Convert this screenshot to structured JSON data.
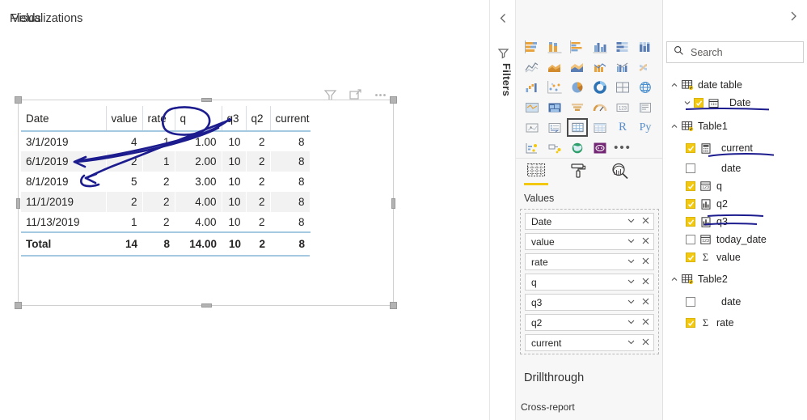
{
  "canvas": {
    "visual_header_icons": [
      "filter-icon",
      "focus-mode-icon",
      "more-options-icon"
    ],
    "table": {
      "columns": [
        "Date",
        "value",
        "rate",
        "q",
        "q3",
        "q2",
        "current"
      ],
      "rows": [
        [
          "3/1/2019",
          "4",
          "1",
          "1.00",
          "10",
          "2",
          "8"
        ],
        [
          "6/1/2019",
          "2",
          "1",
          "2.00",
          "10",
          "2",
          "8"
        ],
        [
          "8/1/2019",
          "5",
          "2",
          "3.00",
          "10",
          "2",
          "8"
        ],
        [
          "11/1/2019",
          "2",
          "2",
          "4.00",
          "10",
          "2",
          "8"
        ],
        [
          "11/13/2019",
          "1",
          "2",
          "4.00",
          "10",
          "2",
          "8"
        ]
      ],
      "total": [
        "Total",
        "14",
        "8",
        "14.00",
        "10",
        "2",
        "8"
      ]
    },
    "annotation_color": "#1c1c8f"
  },
  "filters_pane": {
    "label": "Filters",
    "collapse_icon": "chevron-left-icon",
    "funnel_icon": "filter-icon"
  },
  "visualizations": {
    "title": "Visualizations",
    "expand_icon": "chevron-right-icon",
    "gallery": [
      "stacked-bar-chart",
      "stacked-column-chart",
      "clustered-bar-chart",
      "clustered-column-chart",
      "100-stacked-bar-chart",
      "100-stacked-column-chart",
      "line-chart",
      "area-chart",
      "stacked-area-chart",
      "line-stacked-column-chart",
      "line-clustered-column-chart",
      "ribbon-chart",
      "waterfall-chart",
      "scatter-chart",
      "pie-chart",
      "donut-chart",
      "treemap",
      "map",
      "filled-map",
      "shape-map",
      "funnel-chart",
      "gauge-chart",
      "card",
      "multi-row-card",
      "kpi",
      "slicer",
      "table",
      "matrix",
      "r-script-visual",
      "python-visual",
      "key-influencers",
      "decomposition-tree",
      "arcgis-map",
      "power-apps-visual",
      "more-visuals"
    ],
    "selected_visual": "table",
    "wells_tabs": [
      {
        "name": "fields-tab",
        "icon": "fields-grid-icon",
        "active": true
      },
      {
        "name": "format-tab",
        "icon": "paint-roller-icon",
        "active": false
      },
      {
        "name": "analytics-tab",
        "icon": "magnifier-chart-icon",
        "active": false
      }
    ],
    "wells_title": "Values",
    "wells": [
      {
        "label": "Date"
      },
      {
        "label": "value"
      },
      {
        "label": "rate"
      },
      {
        "label": "q"
      },
      {
        "label": "q3"
      },
      {
        "label": "q2"
      },
      {
        "label": "current"
      }
    ],
    "drillthrough_title": "Drillthrough",
    "cross_report_label": "Cross-report"
  },
  "fields": {
    "title": "Fields",
    "expand_icon": "chevron-right-icon",
    "search_placeholder": "Search",
    "search_value": "",
    "tree": [
      {
        "level": "table",
        "label": "date table",
        "icon": "table-icon",
        "chevron": "chevron-up-icon",
        "checkbox": null,
        "underline": false
      },
      {
        "level": "field-sub",
        "label": "Date",
        "icon": "calendar-icon",
        "chevron": "chevron-down-icon",
        "checkbox": true,
        "underline": true
      },
      {
        "level": "table",
        "label": "Table1",
        "icon": "table-icon",
        "chevron": "chevron-up-icon",
        "checkbox": null,
        "underline": false
      },
      {
        "level": "field",
        "label": "current",
        "icon": "calculator-icon",
        "chevron": null,
        "checkbox": true,
        "underline": true
      },
      {
        "level": "field",
        "label": "date",
        "icon": null,
        "chevron": null,
        "checkbox": false,
        "underline": false
      },
      {
        "level": "field",
        "label": "q",
        "icon": "date-field-icon",
        "chevron": null,
        "checkbox": true,
        "underline": false
      },
      {
        "level": "field",
        "label": "q2",
        "icon": "measure-icon",
        "chevron": null,
        "checkbox": true,
        "underline": false
      },
      {
        "level": "field",
        "label": "q3",
        "icon": "measure-icon",
        "chevron": null,
        "checkbox": true,
        "underline": true
      },
      {
        "level": "field",
        "label": "today_date",
        "icon": "date-field-icon",
        "chevron": null,
        "checkbox": false,
        "underline": false
      },
      {
        "level": "field",
        "label": "value",
        "icon": "sigma-icon",
        "chevron": null,
        "checkbox": true,
        "underline": false
      },
      {
        "level": "table",
        "label": "Table2",
        "icon": "table-icon",
        "chevron": "chevron-up-icon",
        "checkbox": null,
        "underline": false
      },
      {
        "level": "field",
        "label": "date",
        "icon": null,
        "chevron": null,
        "checkbox": false,
        "underline": false
      },
      {
        "level": "field",
        "label": "rate",
        "icon": "sigma-icon",
        "chevron": null,
        "checkbox": true,
        "underline": false
      }
    ]
  },
  "colors": {
    "accent_yellow": "#f2c811",
    "ink_blue": "#1c1c8f",
    "table_rule_blue": "#a6c9e2",
    "pane_bg": "#f7f7f7"
  }
}
